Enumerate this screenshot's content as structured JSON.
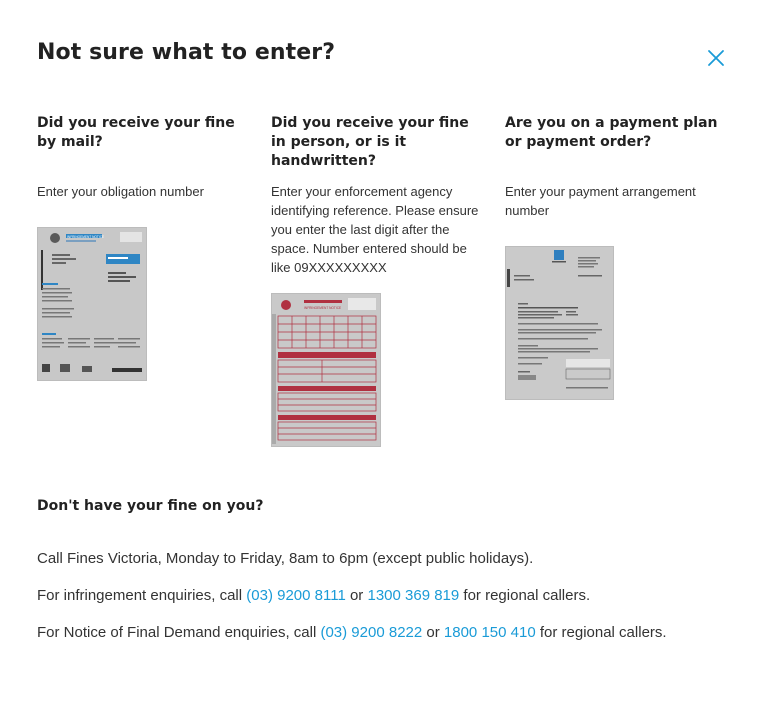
{
  "modal": {
    "title": "Not sure what to enter?",
    "close_icon": "close-icon",
    "accent_color": "#1a9bd7"
  },
  "columns": [
    {
      "heading": "Did you receive your fine by mail?",
      "text": "Enter your obligation number",
      "sample_label": "INFRINGEMENT NOTICE"
    },
    {
      "heading": "Did you receive your fine in person, or is it handwritten?",
      "text": "Enter your enforcement agency identifying reference. Please ensure you enter the last digit after the space. Number entered should be like 09XXXXXXXXX",
      "sample_label": "INFRINGEMENT NOTICE"
    },
    {
      "heading": "Are you on a payment plan or payment order?",
      "text": "Enter your payment arrangement number",
      "sample_label": ""
    }
  ],
  "help": {
    "heading": "Don't have your fine on you?",
    "call_text": "Call Fines Victoria, Monday to Friday, 8am to 6pm (except public holidays).",
    "infringement": {
      "prefix": "For infringement enquiries, call",
      "phone1": "(03) 9200 8111",
      "or": "or",
      "phone2": "1300 369 819",
      "suffix": "for regional callers."
    },
    "final_demand": {
      "prefix": "For Notice of Final Demand enquiries, call",
      "phone1": "(03) 9200 8222",
      "or": "or",
      "phone2": "1800 150 410",
      "suffix": "for regional callers."
    }
  }
}
